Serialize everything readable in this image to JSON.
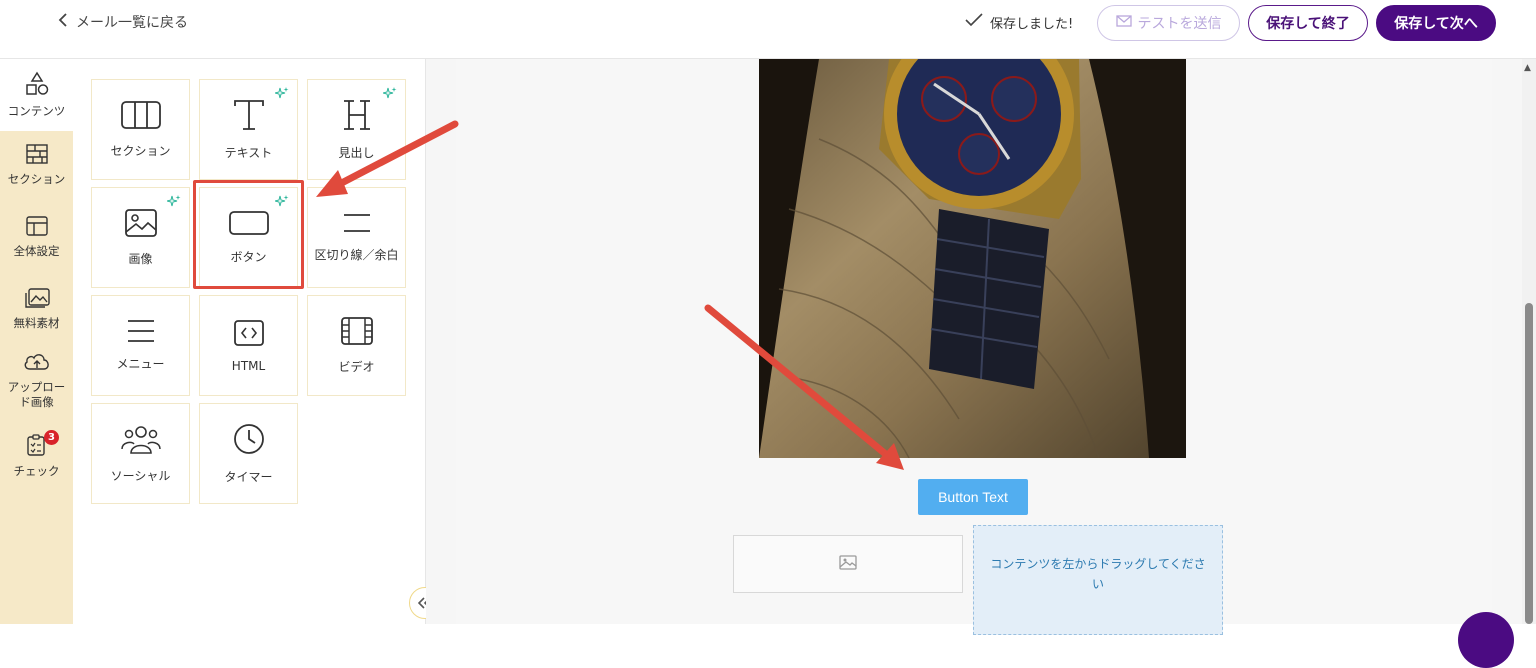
{
  "header": {
    "back_label": "メール一覧に戻る",
    "saved_status": "保存しました!",
    "test_send_label": "テストを送信",
    "save_exit_label": "保存して終了",
    "save_next_label": "保存して次へ"
  },
  "sidebar": {
    "items": [
      {
        "label": "コンテンツ",
        "icon": "shapes-icon"
      },
      {
        "label": "セクション",
        "icon": "bricks-icon"
      },
      {
        "label": "全体設定",
        "icon": "layout-icon"
      },
      {
        "label": "無料素材",
        "icon": "gallery-icon"
      },
      {
        "label": "アップロード画像",
        "icon": "cloud-upload-icon"
      },
      {
        "label": "チェック",
        "icon": "checklist-icon",
        "badge": "3"
      }
    ]
  },
  "content_blocks": [
    {
      "label": "セクション",
      "icon": "columns-icon"
    },
    {
      "label": "テキスト",
      "icon": "text-t-icon",
      "ai": true
    },
    {
      "label": "見出し",
      "icon": "heading-h-icon",
      "ai": true
    },
    {
      "label": "画像",
      "icon": "image-icon",
      "ai": true
    },
    {
      "label": "ボタン",
      "icon": "button-icon",
      "ai": true
    },
    {
      "label": "区切り線／余白",
      "icon": "divider-icon"
    },
    {
      "label": "メニュー",
      "icon": "menu-icon"
    },
    {
      "label": "HTML",
      "icon": "code-icon"
    },
    {
      "label": "ビデオ",
      "icon": "film-icon"
    },
    {
      "label": "ソーシャル",
      "icon": "people-icon"
    },
    {
      "label": "タイマー",
      "icon": "clock-icon"
    }
  ],
  "canvas": {
    "button_text": "Button Text",
    "dropzone_text": "コンテンツを左からドラッグしてください"
  },
  "colors": {
    "accent": "#4b0b82",
    "sidebar_bg": "#f6e9c8",
    "cta_blue": "#52aef0",
    "annotation_red": "#e04a3c"
  }
}
